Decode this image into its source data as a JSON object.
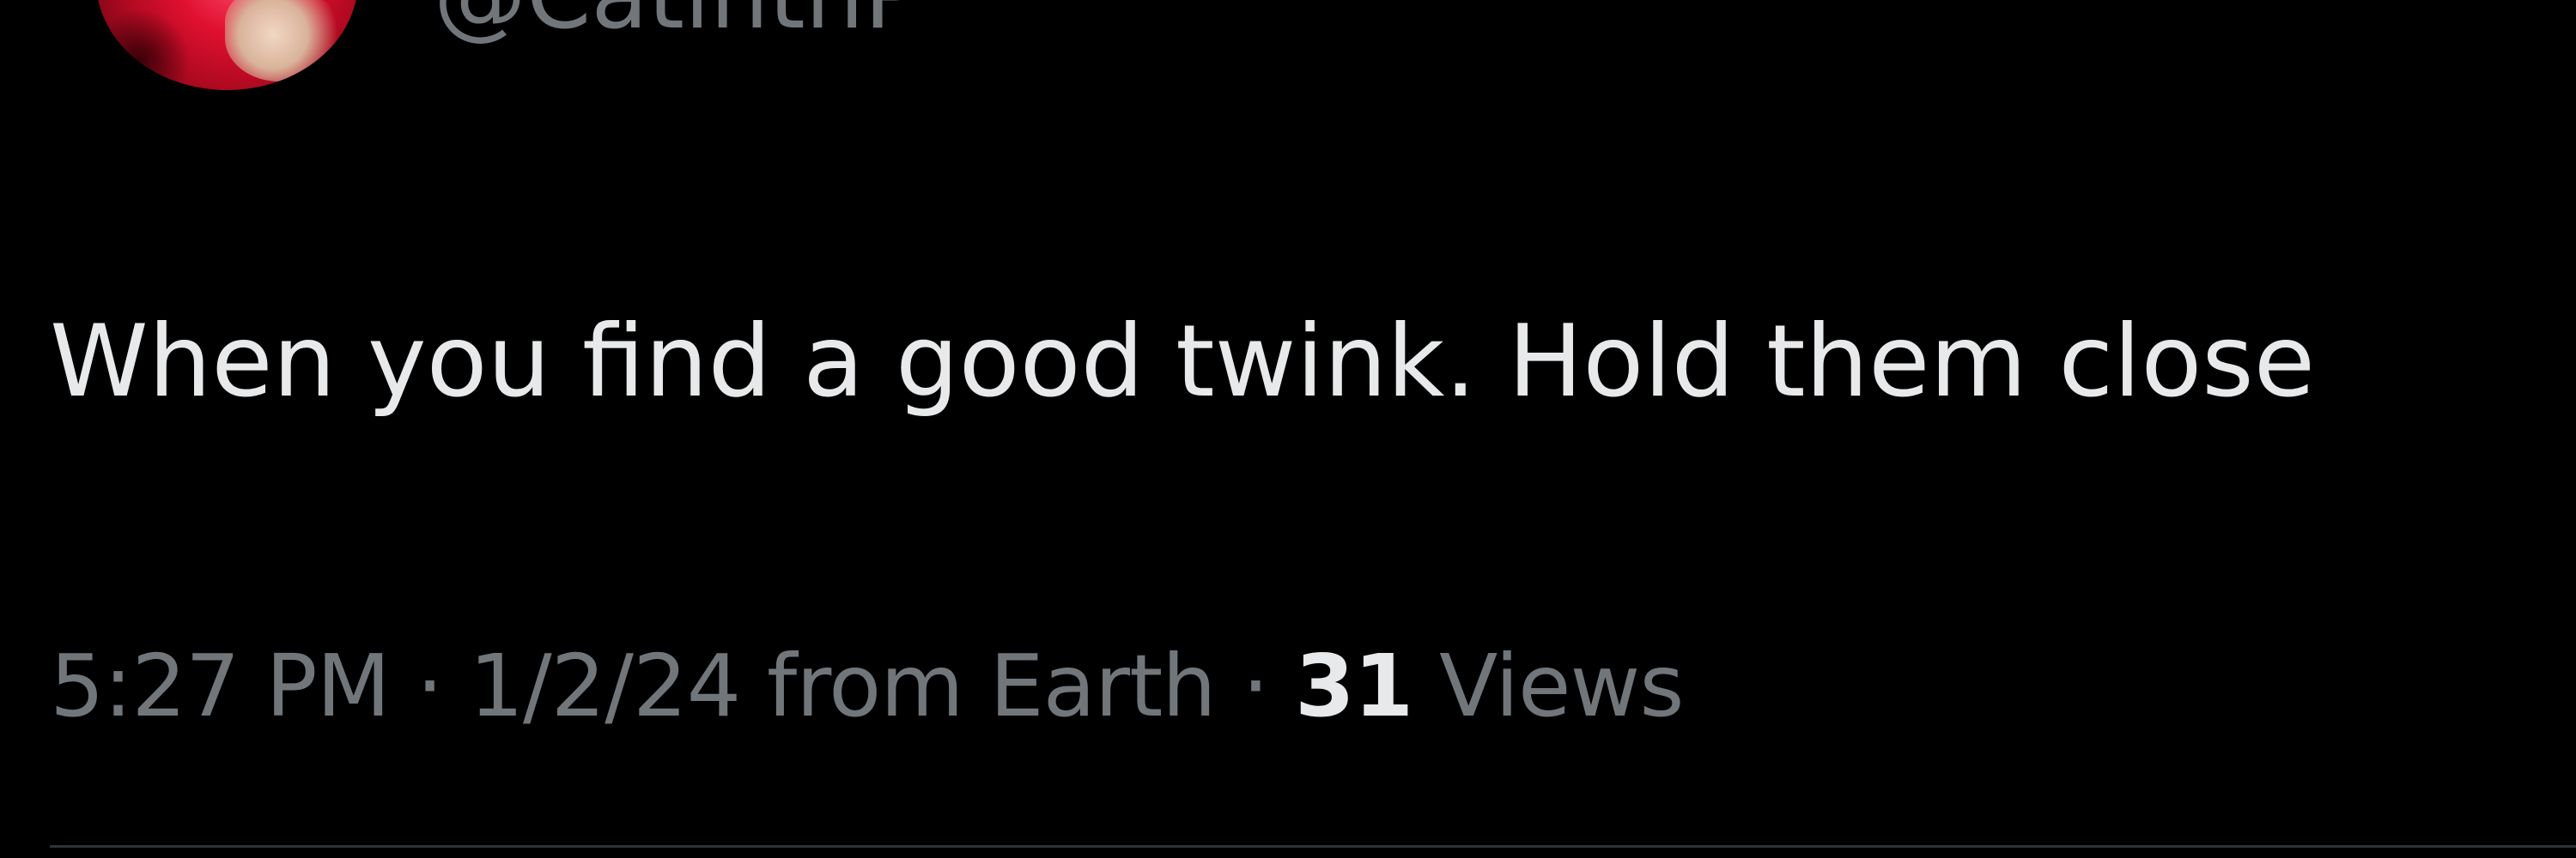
{
  "user": {
    "handle": "@CatinthP",
    "avatar_colors": [
      "#e0102f",
      "#f1d7c4"
    ]
  },
  "tweet": {
    "text": "When you find a good twink. Hold them close",
    "time": "5:27 PM",
    "date": "1/2/24",
    "source": "from Earth",
    "separator": "·",
    "views_count": "31",
    "views_label": "Views"
  },
  "colors": {
    "background": "#000000",
    "primary_text": "#e7e9ea",
    "secondary_text": "#71767b",
    "divider": "#2f3336"
  }
}
